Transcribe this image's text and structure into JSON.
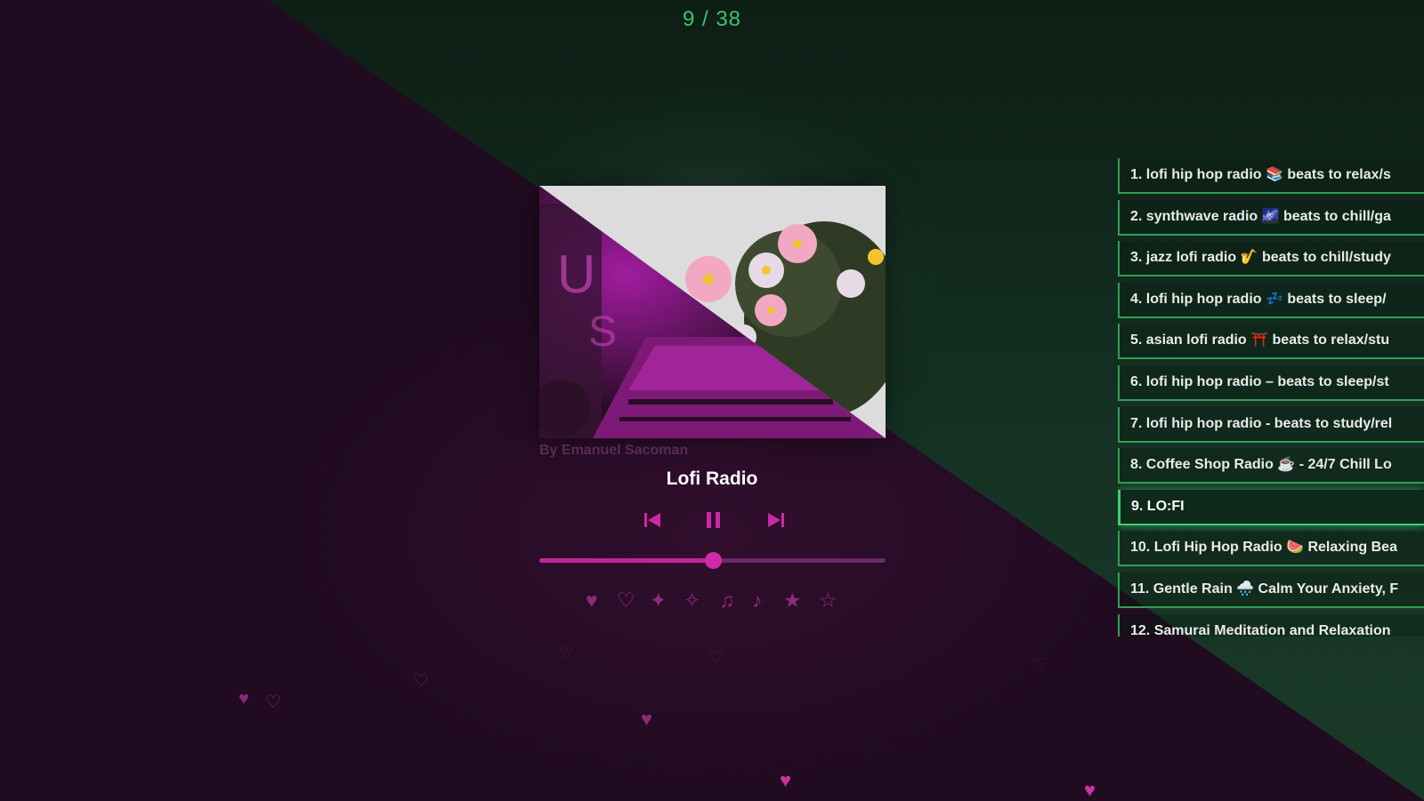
{
  "player": {
    "track_counter": "9 / 38",
    "artist_credit": "By Emanuel Sacoman",
    "title": "Lofi Radio",
    "progress_fraction": 0.5,
    "controls": {
      "prev_icon": "skip-previous-icon",
      "pause_icon": "pause-icon",
      "next_icon": "skip-next-icon"
    },
    "icon_row": [
      {
        "name": "heart-filled-icon",
        "glyph": "♥"
      },
      {
        "name": "heart-outline-icon",
        "glyph": "♡"
      },
      {
        "name": "sparkle-filled-icon",
        "glyph": "✦"
      },
      {
        "name": "sparkle-outline-icon",
        "glyph": "✧"
      },
      {
        "name": "music-notes-icon",
        "glyph": "♫"
      },
      {
        "name": "music-note-icon",
        "glyph": "♪"
      },
      {
        "name": "star-filled-icon",
        "glyph": "★"
      },
      {
        "name": "star-outline-icon",
        "glyph": "☆"
      }
    ]
  },
  "playlist": [
    "1. lofi hip hop radio 📚 beats to relax/s",
    "2. synthwave radio 🌌 beats to chill/ga",
    "3. jazz lofi radio 🎷 beats to chill/study",
    "4. lofi hip hop radio 💤 beats to sleep/",
    "5. asian lofi radio ⛩️ beats to relax/stu",
    "6. lofi hip hop radio – beats to sleep/st",
    "7. lofi hip hop radio - beats to study/rel",
    "8. Coffee Shop Radio ☕ - 24/7 Chill Lo",
    "9. LO:FI",
    "10. Lofi Hip Hop Radio 🍉 Relaxing Bea",
    "11. Gentle Rain 🌧️ Calm Your Anxiety, F",
    "12. Samurai Meditation and Relaxation"
  ],
  "playlist_active_index": 8,
  "colors": {
    "accent_pink": "#c1249f",
    "accent_green": "#39d36a",
    "bg_purple": "#200b20",
    "bg_green": "#153224"
  }
}
